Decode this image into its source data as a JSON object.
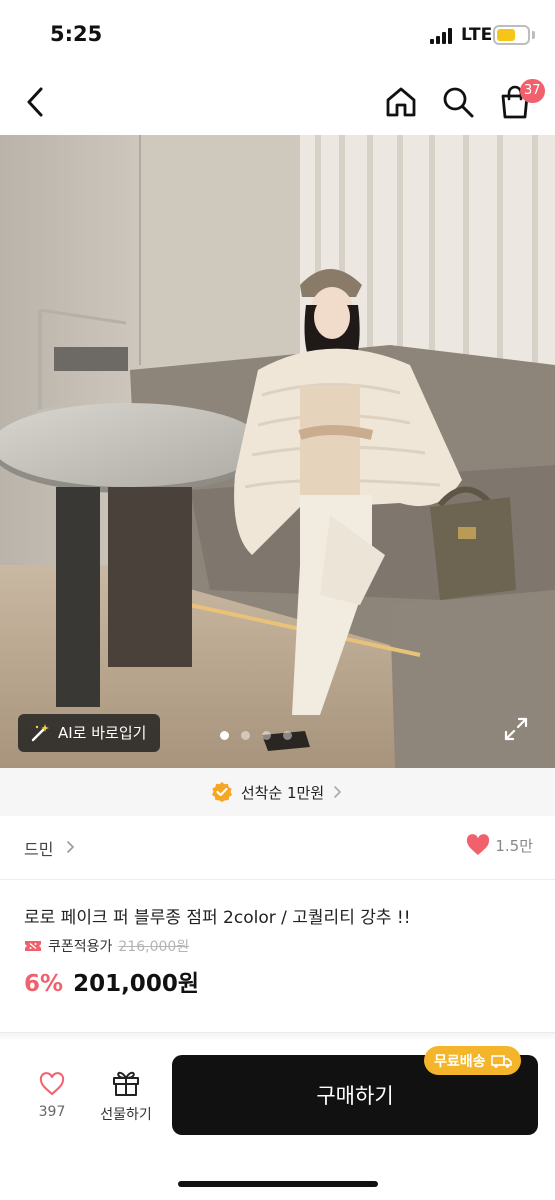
{
  "status_bar": {
    "time": "5:25",
    "network": "LTE",
    "battery_color": "#f5c518"
  },
  "top_nav": {
    "back_icon": "chevron-left-icon",
    "home_icon": "home-icon",
    "search_icon": "search-icon",
    "cart_icon": "shopping-bag-icon",
    "cart_badge": "37",
    "badge_color": "#f0616d"
  },
  "gallery": {
    "ai_chip_label": "AI로 바로입기",
    "ai_icon": "magic-wand-icon",
    "page_count": 4,
    "active_page": 1,
    "expand_icon": "expand-icon"
  },
  "promo": {
    "icon": "check-badge-icon",
    "text": "선착순 1만원"
  },
  "brand": {
    "name": "드민",
    "likes": "1.5만"
  },
  "product": {
    "title": "로로 페이크 퍼 블루종 점퍼  2color  / 고퀄리티 강추 !!",
    "coupon_label": "쿠폰적용가",
    "original_price": "216,000원",
    "discount": "6%",
    "price": "201,000원",
    "accent_color": "#f0616d"
  },
  "bottom_bar": {
    "wish_count": "397",
    "gift_label": "선물하기",
    "buy_label": "구매하기",
    "free_shipping_label": "무료배송",
    "free_shipping_color": "#f5b52a"
  }
}
